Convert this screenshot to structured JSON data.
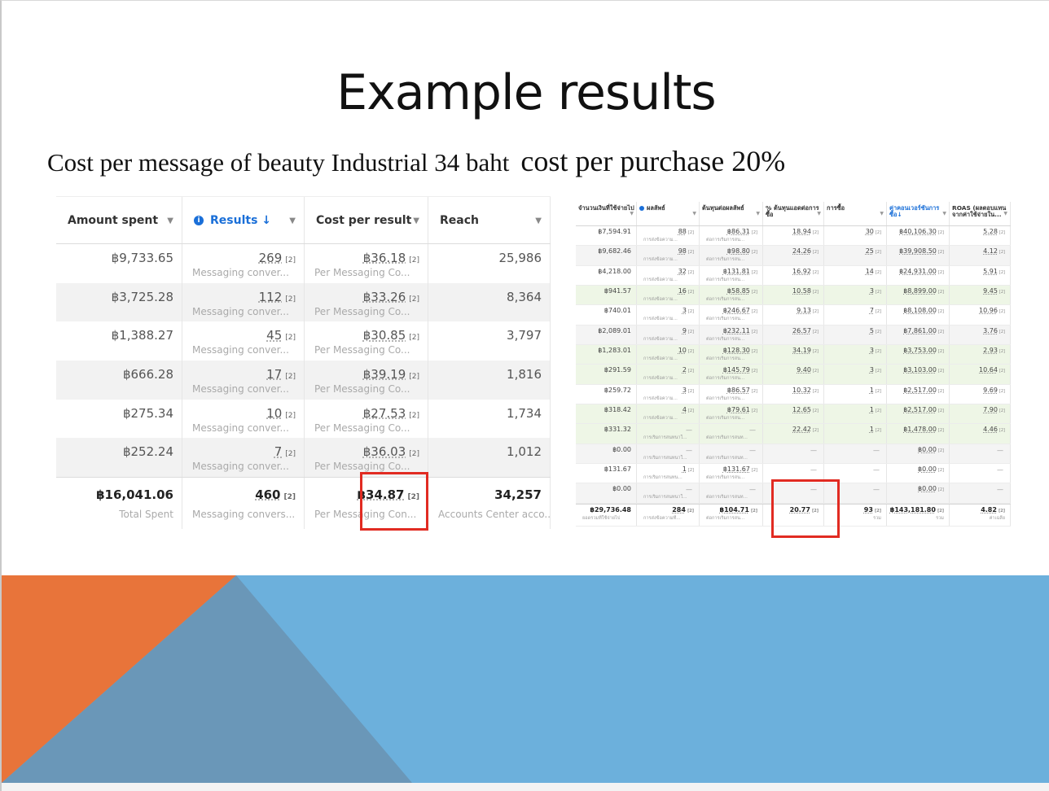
{
  "slide": {
    "title": "Example results",
    "subtitle_left": "Cost per message of beauty Industrial 34 baht",
    "subtitle_right": "cost per purchase 20%",
    "colors": {
      "orange": "#e8743a",
      "blue": "#6cb0dc",
      "slate": "#6a97b8",
      "highlight": "#e12b22"
    }
  },
  "left_table": {
    "headers": [
      "Amount spent",
      "Results ↓",
      "Cost per result",
      "Reach"
    ],
    "rows": [
      {
        "spent": "฿9,733.65",
        "results": "269",
        "results_sub": "Messaging conver...",
        "cpr": "฿36.18",
        "cpr_sub": "Per Messaging Co...",
        "reach": "25,986"
      },
      {
        "spent": "฿3,725.28",
        "results": "112",
        "results_sub": "Messaging conver...",
        "cpr": "฿33.26",
        "cpr_sub": "Per Messaging Co...",
        "reach": "8,364"
      },
      {
        "spent": "฿1,388.27",
        "results": "45",
        "results_sub": "Messaging conver...",
        "cpr": "฿30.85",
        "cpr_sub": "Per Messaging Co...",
        "reach": "3,797"
      },
      {
        "spent": "฿666.28",
        "results": "17",
        "results_sub": "Messaging conver...",
        "cpr": "฿39.19",
        "cpr_sub": "Per Messaging Co...",
        "reach": "1,816"
      },
      {
        "spent": "฿275.34",
        "results": "10",
        "results_sub": "Messaging conver...",
        "cpr": "฿27.53",
        "cpr_sub": "Per Messaging Co...",
        "reach": "1,734"
      },
      {
        "spent": "฿252.24",
        "results": "7",
        "results_sub": "Messaging conver...",
        "cpr": "฿36.03",
        "cpr_sub": "Per Messaging Co...",
        "reach": "1,012"
      }
    ],
    "sup": "[2]",
    "total": {
      "spent": "฿16,041.06",
      "spent_sub": "Total Spent",
      "results": "460",
      "results_sub": "Messaging convers...",
      "cpr": "฿34.87",
      "cpr_sub": "Per Messaging Con...",
      "reach": "34,257",
      "reach_sub": "Accounts Center acco..."
    }
  },
  "right_table": {
    "headers": [
      "จำนวนเงินที่ใช้จ่ายไป",
      "ผลลัพธ์",
      "ต้นทุนต่อผลลัพธ์",
      "% ต้นทุนแอดต่อการซื้อ",
      "การซื้อ",
      "ค่าคอนเวอร์ชันการซื้อ↓",
      "ROAS (ผลตอบแทนจากค่าใช้จ่ายใน..."
    ],
    "sup": "[2]",
    "rows": [
      {
        "spent": "฿7,594.91",
        "res": "88",
        "res_sub": "การส่งข้อความ...",
        "cpr": "฿86.31",
        "cpr_sub": "ต่อการเริ่มการสน...",
        "pct": "18.94",
        "buy": "30",
        "conv": "฿40,106.30",
        "roas": "5.28",
        "tone": "w"
      },
      {
        "spent": "฿9,682.46",
        "res": "98",
        "res_sub": "การส่งข้อความ...",
        "cpr": "฿98.80",
        "cpr_sub": "ต่อการเริ่มการสน...",
        "pct": "24.26",
        "buy": "25",
        "conv": "฿39,908.50",
        "roas": "4.12",
        "tone": "gr"
      },
      {
        "spent": "฿4,218.00",
        "res": "32",
        "res_sub": "การส่งข้อความ...",
        "cpr": "฿131.81",
        "cpr_sub": "ต่อการเริ่มการสน...",
        "pct": "16.92",
        "buy": "14",
        "conv": "฿24,931.00",
        "roas": "5.91",
        "tone": "w"
      },
      {
        "spent": "฿941.57",
        "res": "16",
        "res_sub": "การส่งข้อความ...",
        "cpr": "฿58.85",
        "cpr_sub": "ต่อการเริ่มการสน...",
        "pct": "10.58",
        "buy": "3",
        "conv": "฿8,899.00",
        "roas": "9.45",
        "tone": "g"
      },
      {
        "spent": "฿740.01",
        "res": "3",
        "res_sub": "การส่งข้อความ...",
        "cpr": "฿246.67",
        "cpr_sub": "ต่อการเริ่มการสน...",
        "pct": "9.13",
        "buy": "7",
        "conv": "฿8,108.00",
        "roas": "10.96",
        "tone": "w"
      },
      {
        "spent": "฿2,089.01",
        "res": "9",
        "res_sub": "การส่งข้อความ...",
        "cpr": "฿232.11",
        "cpr_sub": "ต่อการเริ่มการสน...",
        "pct": "26.57",
        "buy": "5",
        "conv": "฿7,861.00",
        "roas": "3.76",
        "tone": "gr"
      },
      {
        "spent": "฿1,283.01",
        "res": "10",
        "res_sub": "การส่งข้อความ...",
        "cpr": "฿128.30",
        "cpr_sub": "ต่อการเริ่มการสน...",
        "pct": "34.19",
        "buy": "3",
        "conv": "฿3,753.00",
        "roas": "2.93",
        "tone": "g"
      },
      {
        "spent": "฿291.59",
        "res": "2",
        "res_sub": "การส่งข้อความ...",
        "cpr": "฿145.79",
        "cpr_sub": "ต่อการเริ่มการสน...",
        "pct": "9.40",
        "buy": "3",
        "conv": "฿3,103.00",
        "roas": "10.64",
        "tone": "g"
      },
      {
        "spent": "฿259.72",
        "res": "3",
        "res_sub": "การส่งข้อความ...",
        "cpr": "฿86.57",
        "cpr_sub": "ต่อการเริ่มการสน...",
        "pct": "10.32",
        "buy": "1",
        "conv": "฿2,517.00",
        "roas": "9.69",
        "tone": "w"
      },
      {
        "spent": "฿318.42",
        "res": "4",
        "res_sub": "การส่งข้อความ...",
        "cpr": "฿79.61",
        "cpr_sub": "ต่อการเริ่มการสน...",
        "pct": "12.65",
        "buy": "1",
        "conv": "฿2,517.00",
        "roas": "7.90",
        "tone": "g"
      },
      {
        "spent": "฿331.32",
        "res": "—",
        "res_sub": "การเริ่มการสนทนาใ...",
        "cpr": "—",
        "cpr_sub": "ต่อการเริ่มการสนท...",
        "pct": "22.42",
        "buy": "1",
        "conv": "฿1,478.00",
        "roas": "4.46",
        "tone": "g"
      },
      {
        "spent": "฿0.00",
        "res": "—",
        "res_sub": "การเริ่มการสนทนาใ...",
        "cpr": "—",
        "cpr_sub": "ต่อการเริ่มการสนท...",
        "pct": "—",
        "buy": "—",
        "conv": "฿0.00",
        "roas": "—",
        "tone": "gr"
      },
      {
        "spent": "฿131.67",
        "res": "1",
        "res_sub": "การเริ่มการสนทน...",
        "cpr": "฿131.67",
        "cpr_sub": "ต่อการเริ่มการสน...",
        "pct": "—",
        "buy": "—",
        "conv": "฿0.00",
        "roas": "—",
        "tone": "w"
      },
      {
        "spent": "฿0.00",
        "res": "—",
        "res_sub": "การเริ่มการสนทนาใ...",
        "cpr": "—",
        "cpr_sub": "ต่อการเริ่มการสนท...",
        "pct": "—",
        "buy": "—",
        "conv": "฿0.00",
        "roas": "—",
        "tone": "gr"
      }
    ],
    "total": {
      "spent": "฿29,736.48",
      "spent_sub": "ยอดรวมที่ใช้จ่ายไป",
      "res": "284",
      "res_sub": "การส่งข้อความที่...",
      "cpr": "฿104.71",
      "cpr_sub": "ต่อการเริ่มการสน...",
      "pct": "20.77",
      "buy": "93",
      "buy_sub": "รวม",
      "conv": "฿143,181.80",
      "conv_sub": "รวม",
      "roas": "4.82",
      "roas_sub": "ค่าเฉลี่ย"
    }
  }
}
